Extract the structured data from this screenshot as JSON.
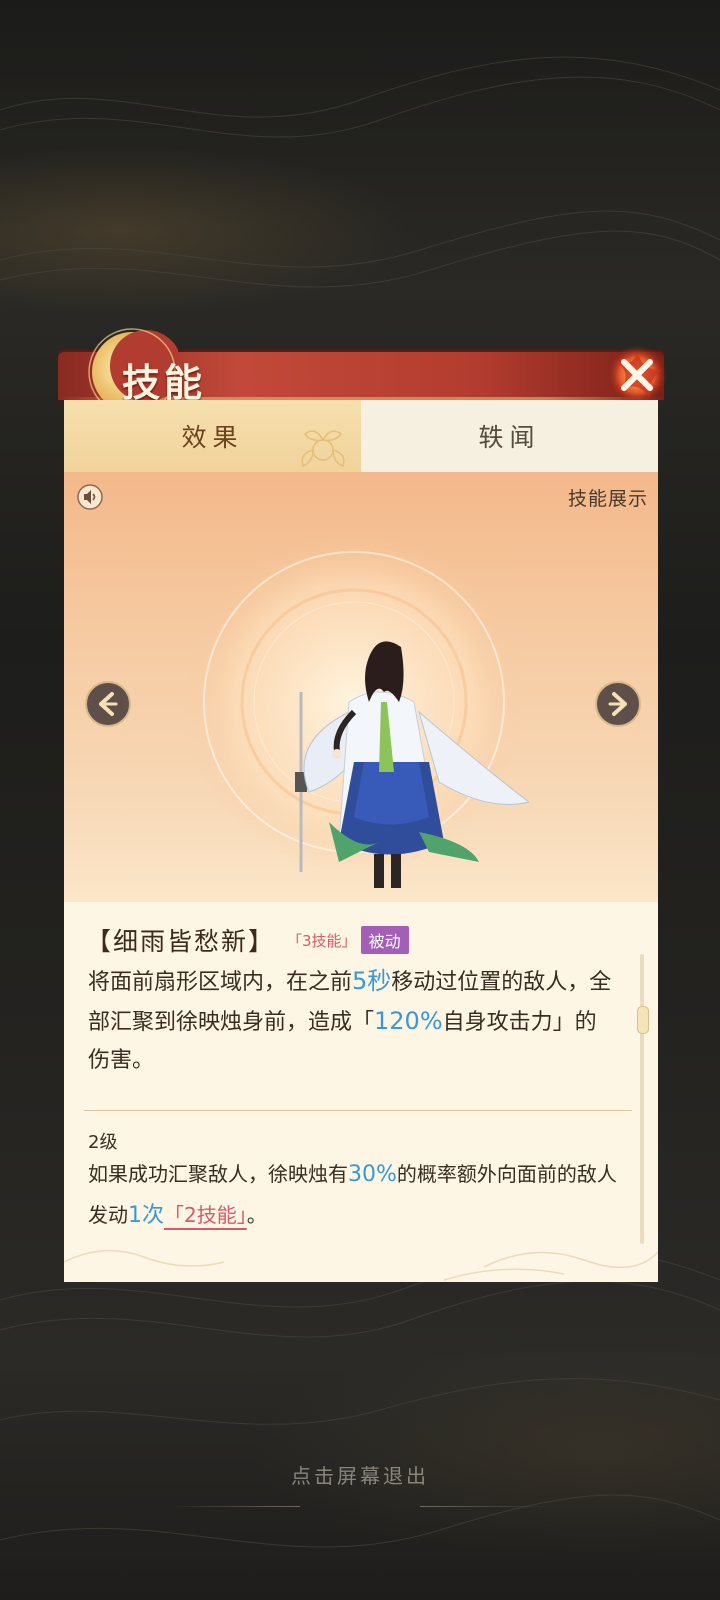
{
  "panel": {
    "title": "技能",
    "tabs": [
      {
        "label": "效果",
        "active": true
      },
      {
        "label": "轶闻",
        "active": false
      }
    ]
  },
  "showcase": {
    "label": "技能展示",
    "sound_icon": "speaker-icon",
    "prev_icon": "chevron-left-icon",
    "next_icon": "chevron-right-icon"
  },
  "skill": {
    "name": "【细雨皆愁新】",
    "slot_tag": "「3技能」",
    "type_tag": "被动",
    "desc_part1": "将面前扇形区域内，在之前",
    "desc_highlight1": "5秒",
    "desc_part2": "移动过位置的敌人，全部汇聚到徐映烛身前，造成「",
    "desc_highlight2": "120%",
    "desc_part3": "自身攻击力」的伤害。"
  },
  "level2": {
    "title": "2级",
    "text_part1": "如果成功汇聚敌人，徐映烛有",
    "highlight1": "30%",
    "text_part2": "的概率额外向面前的敌人发动",
    "highlight2": "1次",
    "link": "「2技能」",
    "text_end": "。"
  },
  "footer": {
    "exit_hint": "点击屏幕退出"
  },
  "colors": {
    "title_bar": "#b23c2f",
    "tab_active": "#f1d39b",
    "highlight_blue": "#3a98d6",
    "tag_pink": "#d45b6d",
    "tag_purple": "#a35fb8"
  }
}
